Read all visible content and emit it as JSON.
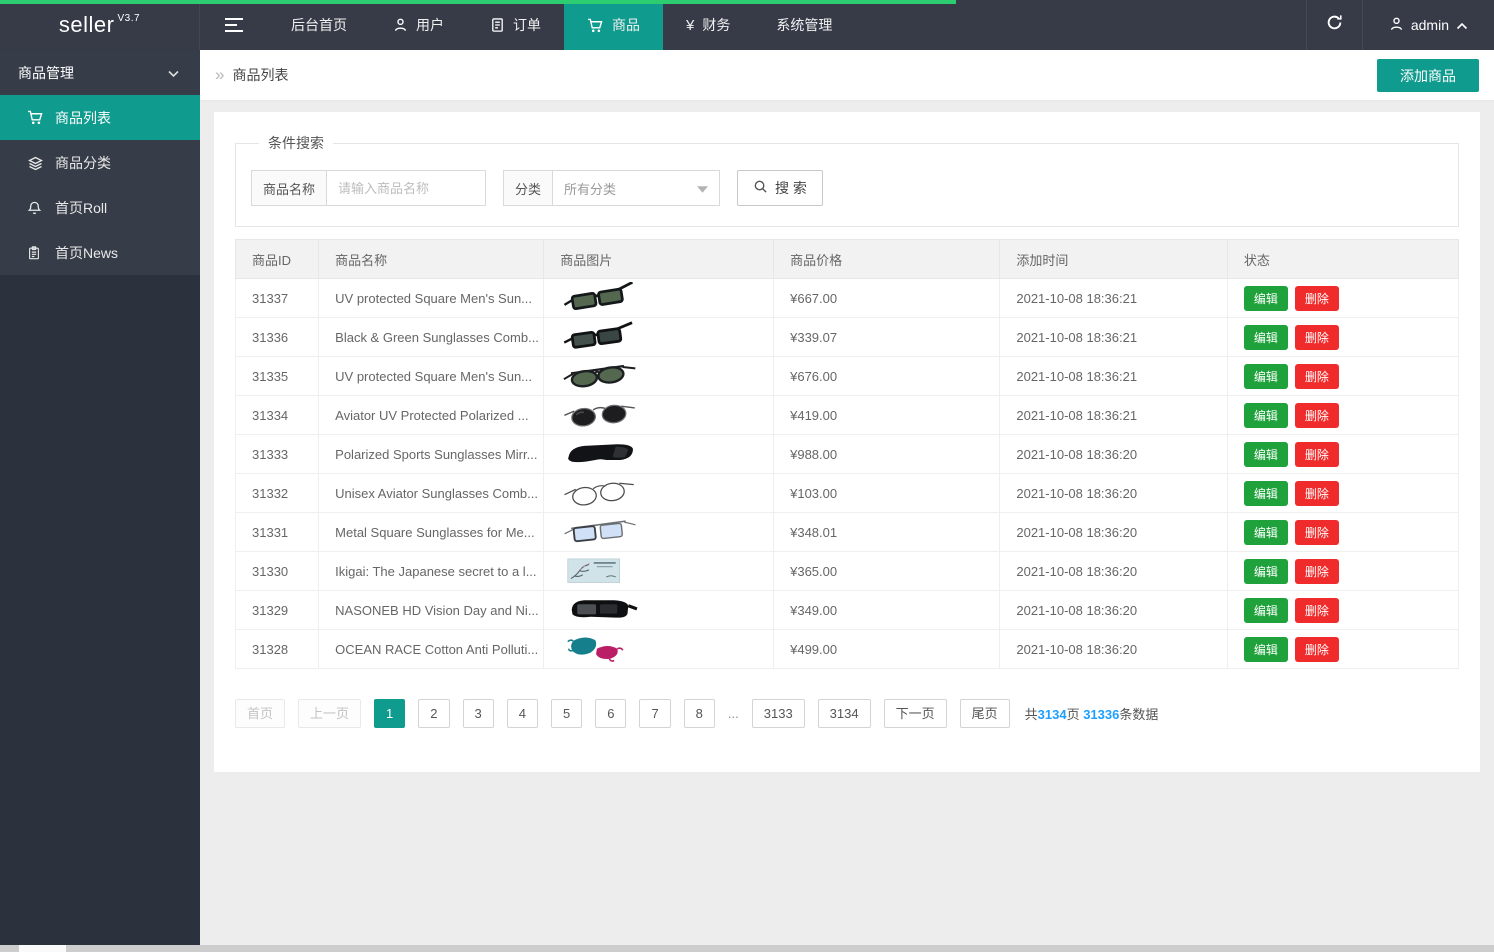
{
  "colors": {
    "accent": "#0f9b8e",
    "loading_bar": "#2ecc71",
    "edit_green": "#1fa23c",
    "delete_red": "#f02b2b",
    "link_blue": "#1e9fff"
  },
  "navbar": {
    "brand": "seller",
    "brand_version": "V3.7",
    "items": [
      {
        "label": "后台首页",
        "icon": null,
        "active": false
      },
      {
        "label": "用户",
        "icon": "user",
        "active": false
      },
      {
        "label": "订单",
        "icon": "document",
        "active": false
      },
      {
        "label": "商品",
        "icon": "cart",
        "active": true
      },
      {
        "label": "财务",
        "icon": "yen",
        "active": false
      },
      {
        "label": "系统管理",
        "icon": null,
        "active": false
      }
    ],
    "admin_label": "admin"
  },
  "sidebar": {
    "group_label": "商品管理",
    "items": [
      {
        "label": "商品列表",
        "icon": "cart",
        "active": true
      },
      {
        "label": "商品分类",
        "icon": "layers",
        "active": false
      },
      {
        "label": "首页Roll",
        "icon": "bell",
        "active": false
      },
      {
        "label": "首页News",
        "icon": "news",
        "active": false
      }
    ]
  },
  "breadcrumb": {
    "title": "商品列表",
    "add_button": "添加商品"
  },
  "search": {
    "legend": "条件搜索",
    "name_label": "商品名称",
    "name_placeholder": "请输入商品名称",
    "category_label": "分类",
    "category_value": "所有分类",
    "button": "搜 索"
  },
  "table": {
    "columns": [
      "商品ID",
      "商品名称",
      "商品图片",
      "商品价格",
      "添加时间",
      "状态"
    ],
    "edit_label": "编辑",
    "delete_label": "删除",
    "rows": [
      {
        "id": "31337",
        "name": "UV protected Square Men's Sun...",
        "image": "wayfarer-green",
        "price": "¥667.00",
        "time": "2021-10-08 18:36:21"
      },
      {
        "id": "31336",
        "name": "Black & Green Sunglasses Comb...",
        "image": "wayfarer-dark",
        "price": "¥339.07",
        "time": "2021-10-08 18:36:21"
      },
      {
        "id": "31335",
        "name": "UV protected Square Men's Sun...",
        "image": "aviator-green",
        "price": "¥676.00",
        "time": "2021-10-08 18:36:21"
      },
      {
        "id": "31334",
        "name": "Aviator UV Protected Polarized ...",
        "image": "aviator-black",
        "price": "¥419.00",
        "time": "2021-10-08 18:36:21"
      },
      {
        "id": "31333",
        "name": "Polarized Sports Sunglasses Mirr...",
        "image": "sport-black",
        "price": "¥988.00",
        "time": "2021-10-08 18:36:20"
      },
      {
        "id": "31332",
        "name": "Unisex Aviator Sunglasses Comb...",
        "image": "aviator-clear",
        "price": "¥103.00",
        "time": "2021-10-08 18:36:20"
      },
      {
        "id": "31331",
        "name": "Metal Square Sunglasses for Me...",
        "image": "square-blue",
        "price": "¥348.01",
        "time": "2021-10-08 18:36:20"
      },
      {
        "id": "31330",
        "name": "Ikigai: The Japanese secret to a l...",
        "image": "book-cover",
        "price": "¥365.00",
        "time": "2021-10-08 18:36:20"
      },
      {
        "id": "31329",
        "name": "NASONEB HD Vision Day and Ni...",
        "image": "fitover-black",
        "price": "¥349.00",
        "time": "2021-10-08 18:36:20"
      },
      {
        "id": "31328",
        "name": "OCEAN RACE Cotton Anti Polluti...",
        "image": "masks",
        "price": "¥499.00",
        "time": "2021-10-08 18:36:20"
      }
    ]
  },
  "pagination": {
    "first": "首页",
    "prev": "上一页",
    "pages": [
      "1",
      "2",
      "3",
      "4",
      "5",
      "6",
      "7",
      "8"
    ],
    "ellipsis": "...",
    "far_pages": [
      "3133",
      "3134"
    ],
    "active_page": "1",
    "next": "下一页",
    "last": "尾页",
    "summary": {
      "prefix": "共",
      "total_pages": "3134",
      "mid": "页 ",
      "total_items": "31336",
      "suffix": "条数据"
    }
  }
}
